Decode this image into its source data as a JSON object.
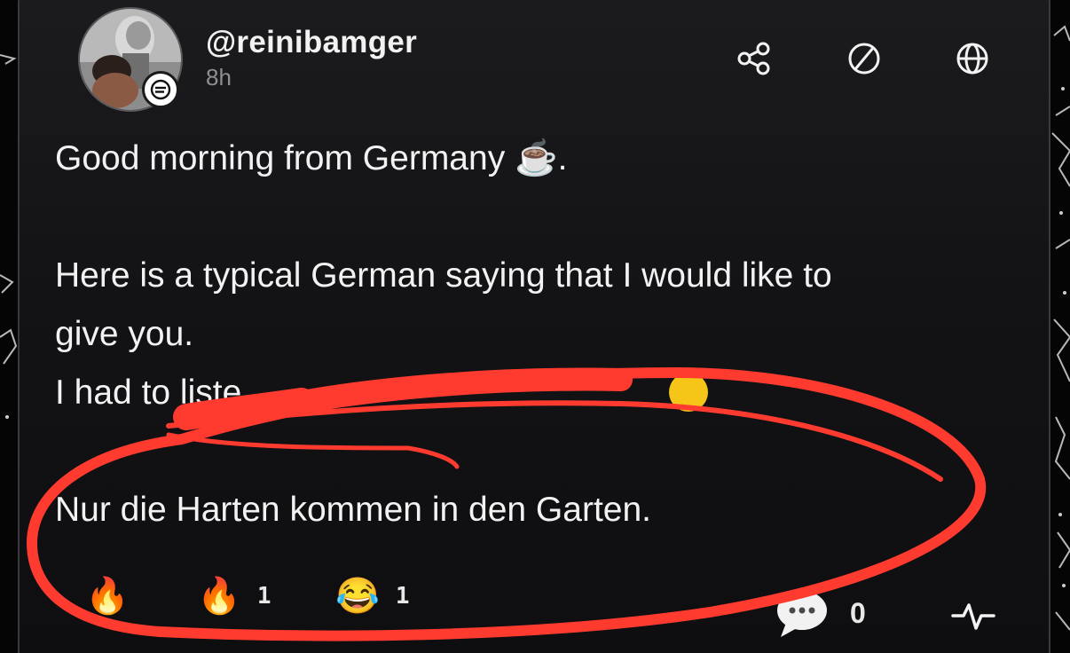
{
  "post": {
    "username": "@reinibamger",
    "timestamp": "8h",
    "lines": {
      "greeting": "Good morning from Germany ☕️.",
      "intro_line1": "Here is a typical German saying that I would like to",
      "intro_line2": "give you.",
      "partial_line": "I had to liste",
      "saying": "Nur die Harten kommen in den Garten."
    }
  },
  "actions": {
    "share_icon": "share-icon",
    "block_icon": "block-icon",
    "globe_icon": "globe-icon"
  },
  "reactions": [
    {
      "emoji": "🔥",
      "count": ""
    },
    {
      "emoji": "🔥",
      "count": "1"
    },
    {
      "emoji": "😂",
      "count": "1"
    }
  ],
  "comments": {
    "count": "0",
    "icon": "speech-bubble-icon"
  },
  "activity_icon": "activity-pulse-icon",
  "colors": {
    "card_bg": "#1c1c1f",
    "text": "#f2f2f2",
    "muted": "#8e8e93",
    "scribble": "#ff3b30"
  }
}
